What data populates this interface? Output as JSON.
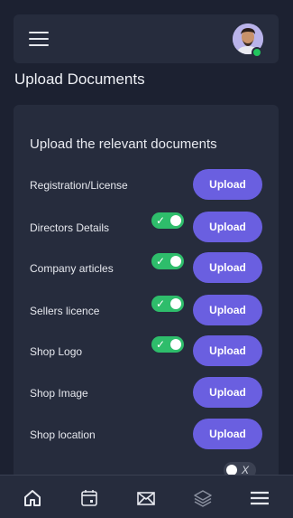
{
  "header": {
    "menu_icon": "hamburger-icon",
    "avatar": "user-avatar",
    "online": true
  },
  "page": {
    "title": "Upload Documents"
  },
  "card": {
    "title": "Upload the relevant documents",
    "rows": [
      {
        "label": "Registration/License",
        "toggle": null,
        "button": "Upload"
      },
      {
        "label": "Directors Details",
        "toggle": "on",
        "toggle_glyph": "✓",
        "button": "Upload"
      },
      {
        "label": "Company articles",
        "toggle": "on",
        "toggle_glyph": "✓",
        "button": "Upload"
      },
      {
        "label": "Sellers licence",
        "toggle": "on",
        "toggle_glyph": "✓",
        "button": "Upload"
      },
      {
        "label": "Shop Logo",
        "toggle": "on",
        "toggle_glyph": "✓",
        "button": "Upload"
      },
      {
        "label": "Shop Image",
        "toggle": null,
        "button": "Upload"
      },
      {
        "label": "Shop location",
        "toggle": null,
        "button": "Upload"
      },
      {
        "label": "",
        "toggle": "off",
        "toggle_glyph": "X",
        "button": null
      }
    ]
  },
  "bottom_nav": [
    "home-icon",
    "calendar-icon",
    "mail-icon",
    "layers-icon",
    "menu-icon"
  ],
  "colors": {
    "background": "#1c2131",
    "surface": "#262c3d",
    "accent": "#6a5fe0",
    "toggle_on": "#2ebd6b"
  }
}
